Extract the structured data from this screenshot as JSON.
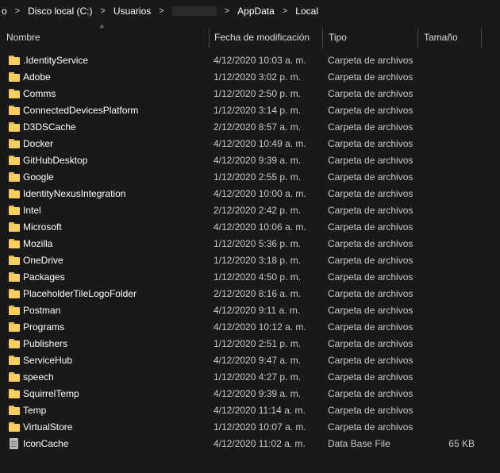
{
  "breadcrumb": {
    "items": [
      "o",
      "Disco local (C:)",
      "Usuarios",
      "",
      "AppData",
      "Local"
    ],
    "separator": ">"
  },
  "columns": {
    "name": "Nombre",
    "date": "Fecha de modificación",
    "type": "Tipo",
    "size": "Tamaño"
  },
  "rows": [
    {
      "name": ".IdentityService",
      "date": "4/12/2020 10:03 a. m.",
      "type": "Carpeta de archivos",
      "size": "",
      "icon": "folder-icon"
    },
    {
      "name": "Adobe",
      "date": "1/12/2020 3:02 p. m.",
      "type": "Carpeta de archivos",
      "size": "",
      "icon": "folder-icon"
    },
    {
      "name": "Comms",
      "date": "1/12/2020 2:50 p. m.",
      "type": "Carpeta de archivos",
      "size": "",
      "icon": "folder-icon"
    },
    {
      "name": "ConnectedDevicesPlatform",
      "date": "1/12/2020 3:14 p. m.",
      "type": "Carpeta de archivos",
      "size": "",
      "icon": "folder-icon"
    },
    {
      "name": "D3DSCache",
      "date": "2/12/2020 8:57 a. m.",
      "type": "Carpeta de archivos",
      "size": "",
      "icon": "folder-icon"
    },
    {
      "name": "Docker",
      "date": "4/12/2020 10:49 a. m.",
      "type": "Carpeta de archivos",
      "size": "",
      "icon": "folder-icon"
    },
    {
      "name": "GitHubDesktop",
      "date": "4/12/2020 9:39 a. m.",
      "type": "Carpeta de archivos",
      "size": "",
      "icon": "folder-icon"
    },
    {
      "name": "Google",
      "date": "1/12/2020 2:55 p. m.",
      "type": "Carpeta de archivos",
      "size": "",
      "icon": "folder-icon"
    },
    {
      "name": "IdentityNexusIntegration",
      "date": "4/12/2020 10:00 a. m.",
      "type": "Carpeta de archivos",
      "size": "",
      "icon": "folder-icon"
    },
    {
      "name": "Intel",
      "date": "2/12/2020 2:42 p. m.",
      "type": "Carpeta de archivos",
      "size": "",
      "icon": "folder-icon"
    },
    {
      "name": "Microsoft",
      "date": "4/12/2020 10:06 a. m.",
      "type": "Carpeta de archivos",
      "size": "",
      "icon": "folder-icon"
    },
    {
      "name": "Mozilla",
      "date": "1/12/2020 5:36 p. m.",
      "type": "Carpeta de archivos",
      "size": "",
      "icon": "folder-icon"
    },
    {
      "name": "OneDrive",
      "date": "1/12/2020 3:18 p. m.",
      "type": "Carpeta de archivos",
      "size": "",
      "icon": "folder-icon"
    },
    {
      "name": "Packages",
      "date": "1/12/2020 4:50 p. m.",
      "type": "Carpeta de archivos",
      "size": "",
      "icon": "folder-icon"
    },
    {
      "name": "PlaceholderTileLogoFolder",
      "date": "2/12/2020 8:16 a. m.",
      "type": "Carpeta de archivos",
      "size": "",
      "icon": "folder-icon"
    },
    {
      "name": "Postman",
      "date": "4/12/2020 9:11 a. m.",
      "type": "Carpeta de archivos",
      "size": "",
      "icon": "folder-icon"
    },
    {
      "name": "Programs",
      "date": "4/12/2020 10:12 a. m.",
      "type": "Carpeta de archivos",
      "size": "",
      "icon": "folder-icon"
    },
    {
      "name": "Publishers",
      "date": "1/12/2020 2:51 p. m.",
      "type": "Carpeta de archivos",
      "size": "",
      "icon": "folder-icon"
    },
    {
      "name": "ServiceHub",
      "date": "4/12/2020 9:47 a. m.",
      "type": "Carpeta de archivos",
      "size": "",
      "icon": "folder-icon"
    },
    {
      "name": "speech",
      "date": "1/12/2020 4:27 p. m.",
      "type": "Carpeta de archivos",
      "size": "",
      "icon": "folder-icon"
    },
    {
      "name": "SquirrelTemp",
      "date": "4/12/2020 9:39 a. m.",
      "type": "Carpeta de archivos",
      "size": "",
      "icon": "folder-icon"
    },
    {
      "name": "Temp",
      "date": "4/12/2020 11:14 a. m.",
      "type": "Carpeta de archivos",
      "size": "",
      "icon": "folder-icon"
    },
    {
      "name": "VirtualStore",
      "date": "1/12/2020 10:07 a. m.",
      "type": "Carpeta de archivos",
      "size": "",
      "icon": "folder-icon"
    },
    {
      "name": "IconCache",
      "date": "4/12/2020 11:02 a. m.",
      "type": "Data Base File",
      "size": "65 KB",
      "icon": "database-file-icon"
    }
  ]
}
